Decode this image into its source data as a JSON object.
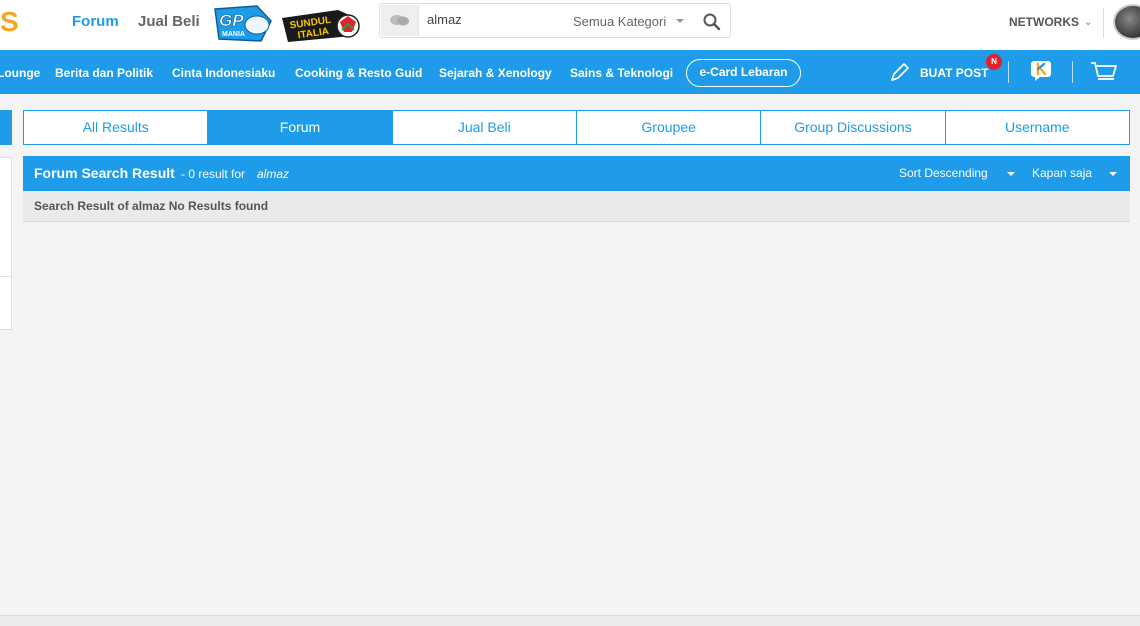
{
  "header": {
    "logo_fragment": "S",
    "nav": {
      "forum": "Forum",
      "jual_beli": "Jual Beli"
    },
    "badges": {
      "gp": {
        "line1": "GP",
        "line2": "MANIA"
      },
      "sundul": {
        "line1": "SUNDUL",
        "line2": "ITALIA"
      }
    },
    "search": {
      "value": "almaz",
      "category": "Semua Kategori"
    },
    "networks": "NETWORKS"
  },
  "category_bar": {
    "items": [
      "Lounge",
      "Berita dan Politik",
      "Cinta Indonesiaku",
      "Cooking & Resto Guid",
      "Sejarah & Xenology",
      "Sains & Teknologi"
    ],
    "ecard": "e-Card Lebaran",
    "buat_post": "BUAT POST",
    "new_badge": "N"
  },
  "tabs": [
    "All Results",
    "Forum",
    "Jual Beli",
    "Groupee",
    "Group Discussions",
    "Username"
  ],
  "active_tab": "Forum",
  "results": {
    "title": "Forum Search Result",
    "count_text": "- 0 result for",
    "term": "almaz",
    "sort": "Sort Descending",
    "time": "Kapan saja",
    "message": "Search Result of almaz No Results found"
  },
  "colors": {
    "primary": "#1e9be9",
    "accent": "#f5a623",
    "badge_red": "#e3202e"
  }
}
